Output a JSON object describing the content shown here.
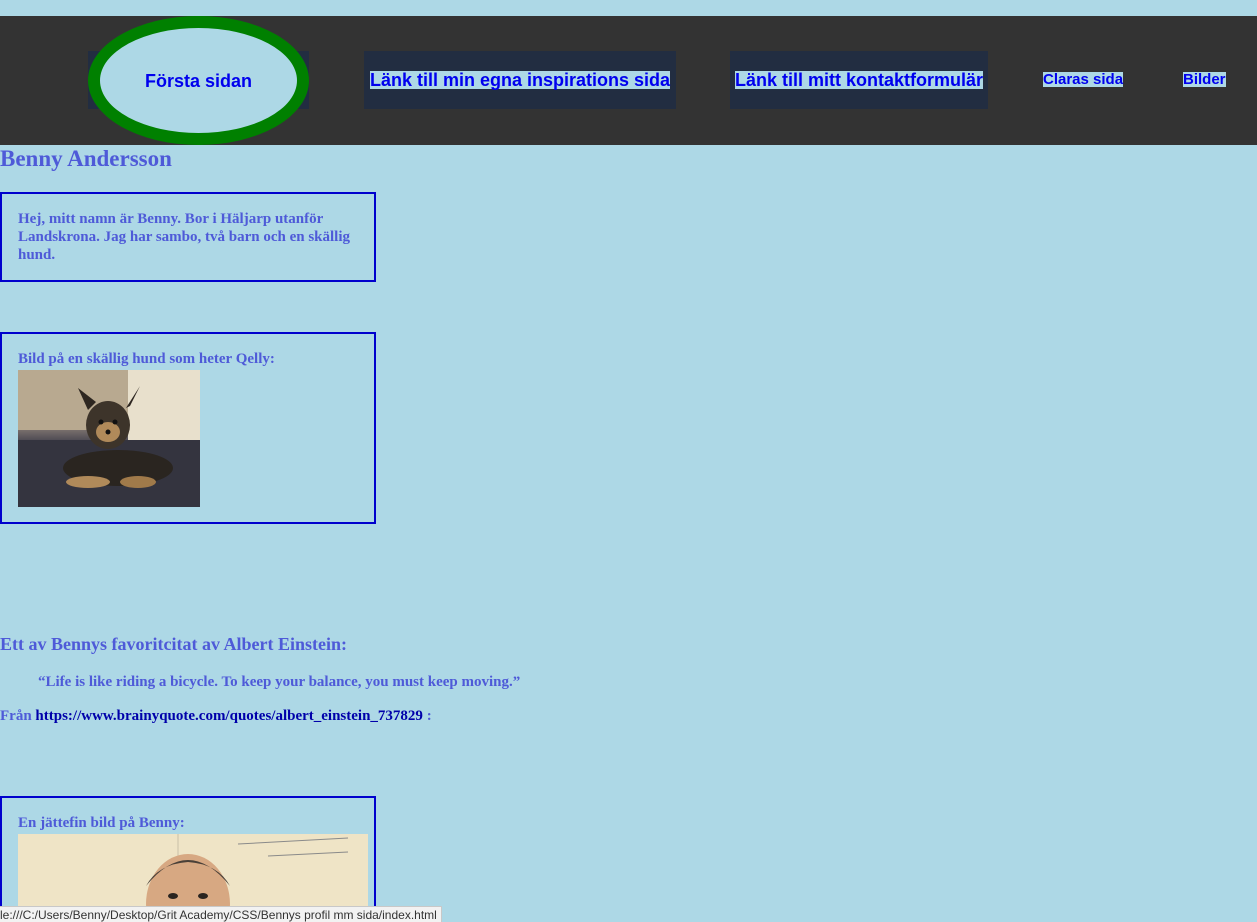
{
  "nav": {
    "home": "Första sidan",
    "inspiration": "Länk till min egna inspirations sida",
    "contact": "Länk till mitt kontaktformulär",
    "claras": "Claras sida",
    "bilder": "Bilder"
  },
  "page": {
    "title": "Benny Andersson"
  },
  "intro": {
    "text": "Hej, mitt namn är Benny. Bor i Häljarp utanför Landskrona. Jag har sambo, två barn och en skällig hund."
  },
  "dog": {
    "caption": "Bild på en skällig hund som heter Qelly:"
  },
  "quote": {
    "heading": "Ett av Bennys favoritcitat av Albert Einstein:",
    "text": "“Life is like riding a bicycle. To keep your balance, you must keep moving.”",
    "source_prefix": "Från",
    "source_url": "https://www.brainyquote.com/quotes/albert_einstein_737829",
    "source_suffix": ":"
  },
  "benny_photo": {
    "caption": "En jättefin bild på Benny:"
  },
  "status_bar": {
    "text": "le:///C:/Users/Benny/Desktop/Grit Academy/CSS/Bennys profil mm sida/index.html"
  },
  "colors": {
    "page_bg": "#add8e6",
    "navbar_bg": "#333333",
    "link": "#0000ee",
    "heading_text": "#4e5ad8",
    "card_border": "#0000cd",
    "home_ring": "#008000"
  }
}
